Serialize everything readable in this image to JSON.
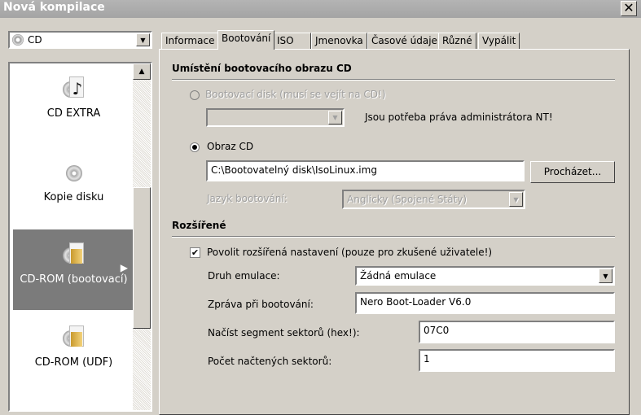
{
  "window": {
    "title": "Nová kompilace",
    "close": "✕"
  },
  "disc_type": {
    "selected": "CD"
  },
  "sidebar": {
    "items": [
      {
        "label": "CD EXTRA",
        "icon": "cd-audio-icon"
      },
      {
        "label": "Kopie disku",
        "icon": "disc-copy-icon"
      },
      {
        "label": "CD-ROM (bootovací)",
        "icon": "cd-rom-boot-icon",
        "selected": true
      },
      {
        "label": "CD-ROM (UDF)",
        "icon": "cd-rom-udf-icon"
      }
    ]
  },
  "tabs": [
    {
      "label": "Informace"
    },
    {
      "label": "Bootování",
      "active": true
    },
    {
      "label": "ISO"
    },
    {
      "label": "Jmenovka"
    },
    {
      "label": "Časové údaje"
    },
    {
      "label": "Různé"
    },
    {
      "label": "Vypálit"
    }
  ],
  "boot": {
    "section1": "Umístění bootovacího obrazu CD",
    "boot_disk_label": "Bootovací disk (musí se vejít na CD!)",
    "admin_note": "Jsou potřeba práva administrátora NT!",
    "image_label": "Obraz CD",
    "image_path": "C:\\Bootovatelný disk\\IsoLinux.img",
    "browse": "Procházet...",
    "lang_label": "Jazyk bootování:",
    "lang_value": "Anglicky (Spojené Státy)",
    "section2": "Rozšířené",
    "advanced_label": "Povolit rozšířená nastavení (pouze pro zkušené uživatele!)",
    "emulation_label": "Druh emulace:",
    "emulation_value": "Žádná emulace",
    "message_label": "Zpráva při bootování:",
    "message_value": "Nero Boot-Loader V6.0",
    "segment_label": "Načíst segment sektorů (hex!):",
    "segment_value": "07C0",
    "sectors_label": "Počet načtených sektorů:",
    "sectors_value": "1"
  }
}
